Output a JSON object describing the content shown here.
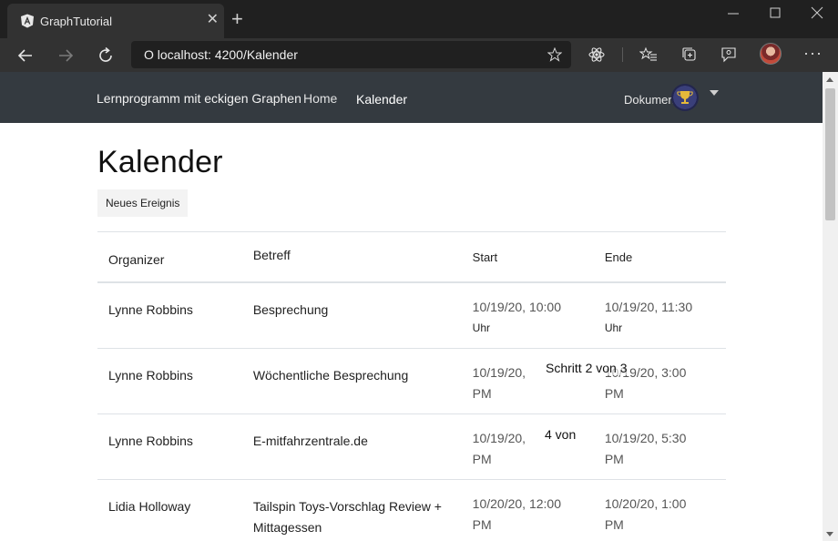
{
  "browser": {
    "tab_title": "GraphTutorial",
    "url": "O localhost: 4200/Kalender"
  },
  "app_nav": {
    "brand": "Lernprogramm mit eckigen Graphen",
    "home": "Home",
    "calendar": "Kalender",
    "documents": "Dokumente"
  },
  "page": {
    "title": "Kalender",
    "new_event": "Neues Ereignis"
  },
  "table": {
    "headers": {
      "organizer": "Organizer",
      "subject": "Betreff",
      "start": "Start",
      "end": "Ende"
    },
    "rows": [
      {
        "organizer": "Lynne Robbins",
        "subject": "Besprechung",
        "start_a": "10/19/20, 10:00",
        "start_b": "Uhr",
        "end_a": "10/19/20, 11:30",
        "end_b": "Uhr"
      },
      {
        "organizer": "Lynne Robbins",
        "subject": "Wöchentliche Besprechung",
        "start_a": "10/19/20,",
        "start_b": "PM",
        "end_a": "10/19/20, 3:00",
        "end_b": "PM"
      },
      {
        "organizer": "Lynne Robbins",
        "subject": "E-mitfahrzentrale.de",
        "start_a": "10/19/20,",
        "start_b": "PM",
        "end_a": "10/19/20, 5:30",
        "end_b": "PM"
      },
      {
        "organizer": "Lidia Holloway",
        "subject_a": "Tailspin Toys-Vorschlag Review +",
        "subject_b": "Mittagessen",
        "start_a": "10/20/20, 12:00",
        "start_b": "PM",
        "end_a": "10/20/20, 1:00",
        "end_b": "PM"
      }
    ]
  },
  "overlays": {
    "step": "Schritt 2 von 3",
    "four_of": "4 von"
  },
  "colors": {
    "navbar": "#343a40",
    "chrome_dark": "#202020",
    "chrome_mid": "#323232"
  }
}
